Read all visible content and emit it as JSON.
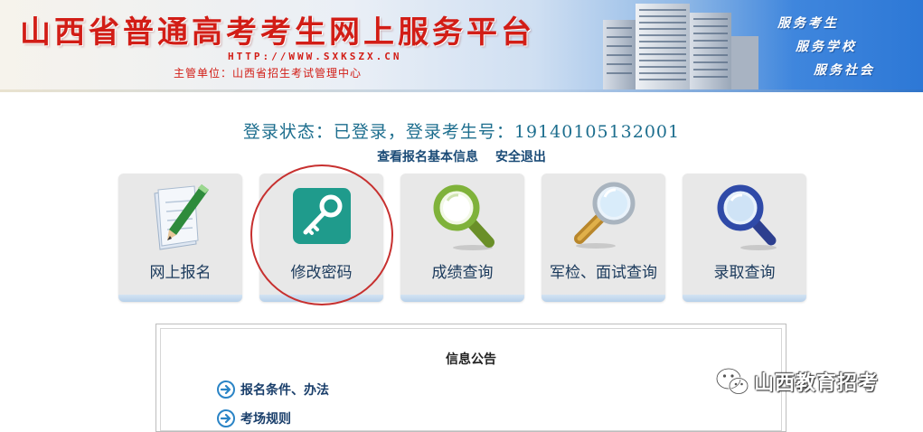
{
  "header": {
    "title": "山西省普通高考考生网上服务平台",
    "url": "HTTP://WWW.SXKSZX.CN",
    "org": "主管单位：山西省招生考试管理中心",
    "slogans": [
      "服务考生",
      "服务学校",
      "服务社会"
    ]
  },
  "status": {
    "text": "登录状态：已登录，登录考生号：19140105132001",
    "links": [
      "查看报名基本信息",
      "安全退出"
    ]
  },
  "tiles": [
    {
      "label": "网上报名",
      "icon": "notepad-pencil-icon"
    },
    {
      "label": "修改密码",
      "icon": "key-icon"
    },
    {
      "label": "成绩查询",
      "icon": "magnifier-green-icon"
    },
    {
      "label": "军检、面试查询",
      "icon": "magnifier-gold-icon"
    },
    {
      "label": "录取查询",
      "icon": "magnifier-blue-icon"
    }
  ],
  "notice": {
    "title": "信息公告",
    "items": [
      "报名条件、办法",
      "考场规则"
    ]
  },
  "watermark": {
    "text": "山西教育招考"
  },
  "colors": {
    "title_red": "#d21d16",
    "status_blue": "#1d6e8e",
    "key_teal": "#1f9b8c",
    "ring_red": "#c7302f"
  }
}
